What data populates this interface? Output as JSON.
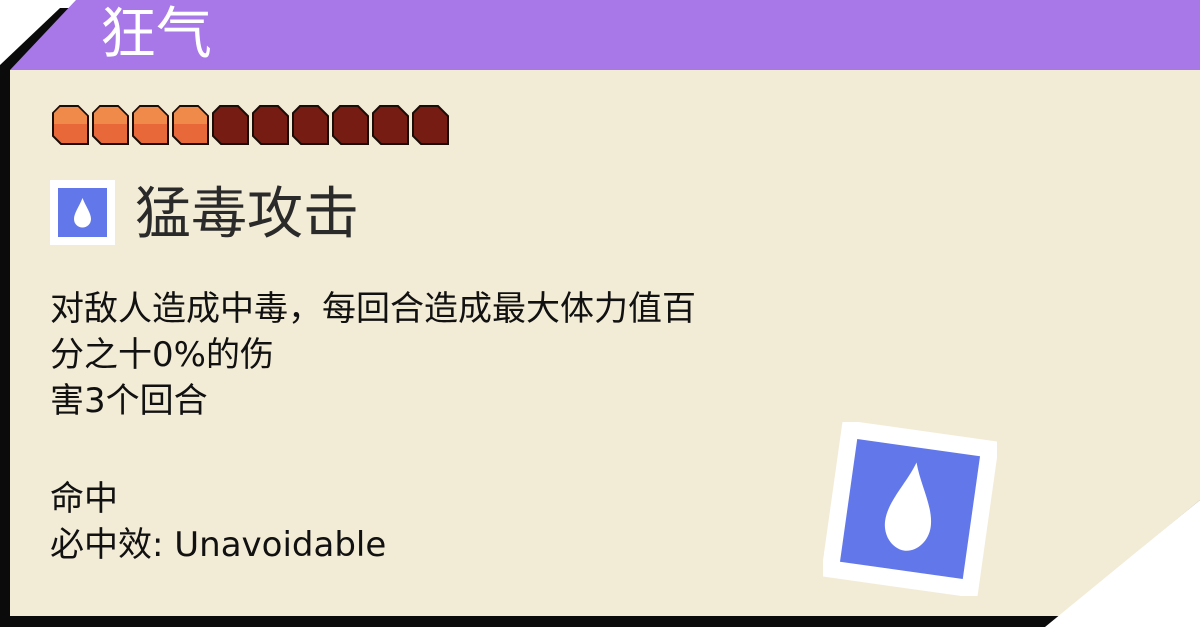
{
  "card": {
    "header_title": "狂气",
    "colors": {
      "header": "#a877e8",
      "panel": "#f2ebd6",
      "frame": "#0b0b0b",
      "pp_filled": "#e8683a",
      "pp_empty": "#761c12",
      "icon_blue": "#6278ea"
    }
  },
  "cost": {
    "filled": 4,
    "total": 10
  },
  "skill": {
    "icon": "water-drop-icon",
    "name": "猛毒攻击",
    "description_line1": "对敌人造成中毒，每回合造成最大体力值百分之十0%的伤",
    "description_line2": "害3个回合"
  },
  "meta": {
    "line1": "命中",
    "line2": "必中效: Unavoidable"
  }
}
